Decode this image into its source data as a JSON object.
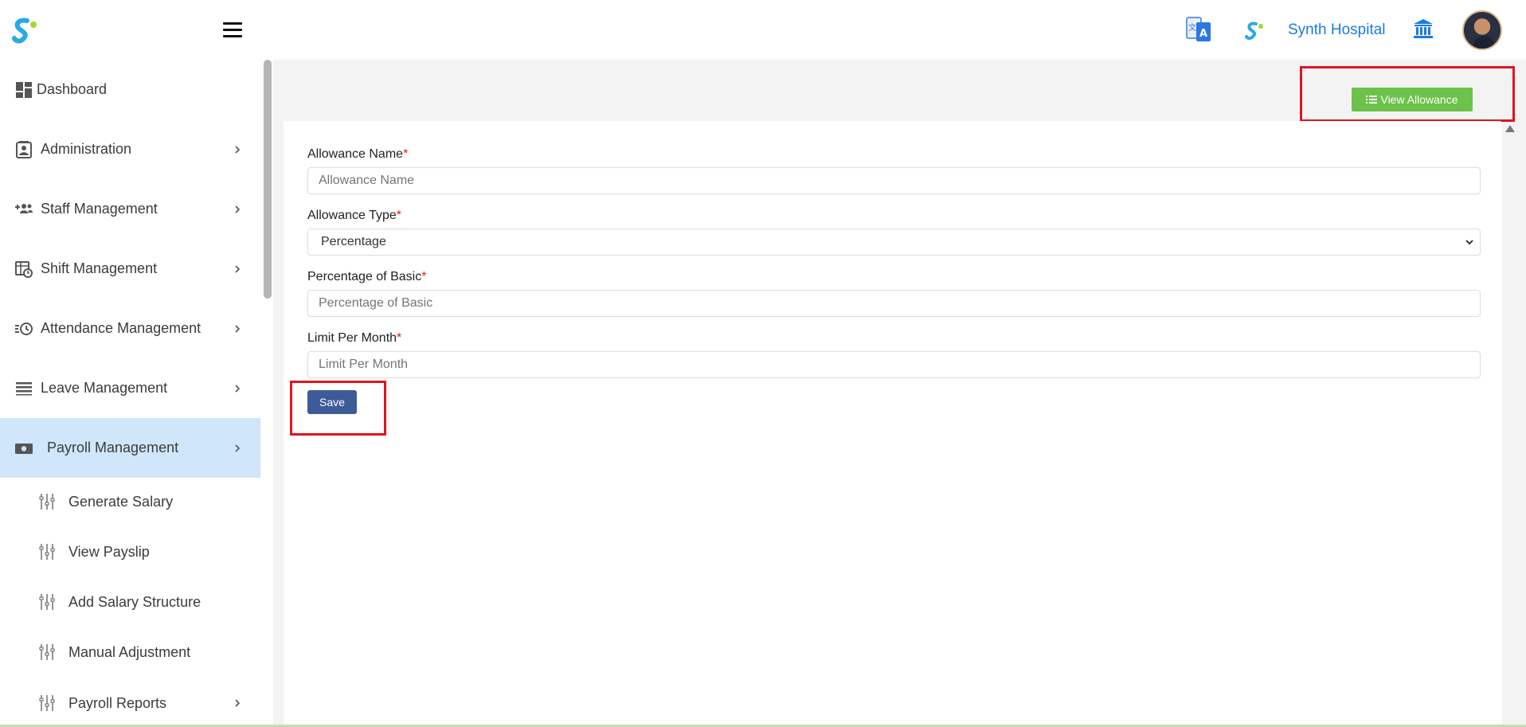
{
  "header": {
    "brand_name": "Synth Hospital"
  },
  "sidebar": {
    "items": [
      {
        "label": "Dashboard",
        "icon": "dashboard-icon"
      },
      {
        "label": "Administration",
        "icon": "contact-card-icon"
      },
      {
        "label": "Staff Management",
        "icon": "add-group-icon"
      },
      {
        "label": "Shift Management",
        "icon": "calendar-clock-icon"
      },
      {
        "label": "Attendance Management",
        "icon": "history-icon"
      },
      {
        "label": "Leave Management",
        "icon": "list-lines-icon"
      },
      {
        "label": "Payroll Management",
        "icon": "money-icon",
        "active": true
      }
    ],
    "subitems": [
      {
        "label": "Generate Salary",
        "icon": "sliders-icon"
      },
      {
        "label": "View Payslip",
        "icon": "sliders-icon"
      },
      {
        "label": "Add Salary Structure",
        "icon": "sliders-icon"
      },
      {
        "label": "Manual Adjustment",
        "icon": "sliders-icon"
      },
      {
        "label": "Payroll Reports",
        "icon": "sliders-icon"
      }
    ]
  },
  "toolbar": {
    "view_allowance_label": "View Allowance"
  },
  "form": {
    "allowance_name": {
      "label": "Allowance Name",
      "required": "*",
      "placeholder": "Allowance Name",
      "value": ""
    },
    "allowance_type": {
      "label": "Allowance Type",
      "required": "*",
      "value": "Percentage"
    },
    "percentage_of_basic": {
      "label": "Percentage of Basic",
      "required": "*",
      "placeholder": "Percentage of Basic",
      "value": ""
    },
    "limit_per_month": {
      "label": "Limit Per Month",
      "required": "*",
      "placeholder": "Limit Per Month",
      "value": ""
    },
    "save_label": "Save"
  },
  "colors": {
    "accent_blue": "#1a7be0",
    "active_bg": "#cfe6fb",
    "view_button": "#6cc24a",
    "save_button": "#3d5a99",
    "highlight": "#e0141e",
    "required": "#e01b1b"
  }
}
